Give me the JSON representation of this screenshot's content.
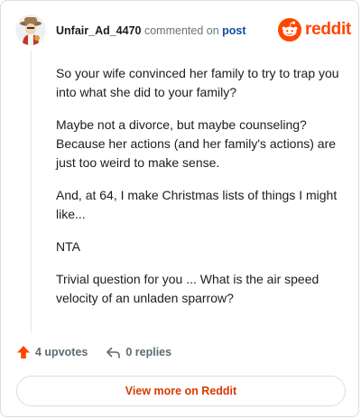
{
  "comment": {
    "username": "Unfair_Ad_4470",
    "commented_on_text": "commented on",
    "post_link": "post",
    "paragraphs": [
      "So your wife convinced her family to try to trap you into what she did to your family?",
      "Maybe not a divorce, but maybe counseling? Because her actions (and her family's actions) are just too weird to make sense.",
      "And, at 64, I make Christmas lists of things I might like...",
      "NTA",
      "Trivial question for you ... What is the air speed velocity of an unladen sparrow?"
    ]
  },
  "brand": {
    "wordmark": "reddit",
    "icon": "reddit-snoo-icon",
    "color": "#ff4500"
  },
  "actions": {
    "upvotes": "4 upvotes",
    "replies": "0 replies",
    "upvote_icon": "upvote-arrow-icon",
    "reply_icon": "reply-arrow-icon",
    "upvote_color": "#ff4500"
  },
  "footer": {
    "view_more": "View more on Reddit"
  }
}
